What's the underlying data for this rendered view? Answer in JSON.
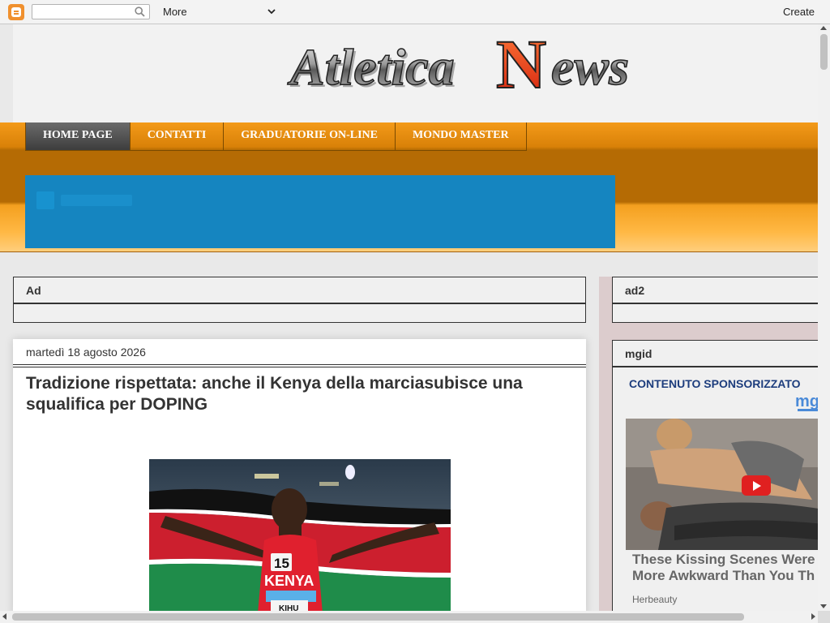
{
  "navbar": {
    "search_placeholder": "",
    "more_label": "More",
    "create_label": "Create"
  },
  "header": {
    "logo_text_1": "Atletica",
    "logo_text_big_n": "N",
    "logo_text_2": "ews",
    "logo_alt": "Atletica News"
  },
  "menu": {
    "items": [
      {
        "label": "HOME PAGE",
        "active": true
      },
      {
        "label": "CONTATTI",
        "active": false
      },
      {
        "label": "GRADUATORIE ON-LINE",
        "active": false
      },
      {
        "label": "MONDO MASTER",
        "active": false
      }
    ]
  },
  "widgets": {
    "ad_title": "Ad",
    "ad2_title": "ad2",
    "mgid_title": "mgid"
  },
  "post": {
    "date": "martedì 18 agosto 2026",
    "title": "Tradizione rispettata: anche il Kenya della marciasubisce una squalifica per DOPING",
    "image": {
      "bib_number": "15",
      "shirt_text": "KENYA",
      "bib_name": "KIHU"
    }
  },
  "mgid": {
    "sponsored_label": "CONTENUTO SPONSORIZZATO",
    "logo_text": "mg",
    "headline_line1": "These Kissing Scenes Were",
    "headline_line2": "More Awkward Than You Th",
    "source": "Herbeauty"
  },
  "colors": {
    "brand_orange": "#f39a19",
    "menu_active": "#4a4a4a",
    "banner_blue": "#1585c0",
    "sponsored_blue": "#1d3d7d",
    "logo_red": "#e8401c"
  }
}
